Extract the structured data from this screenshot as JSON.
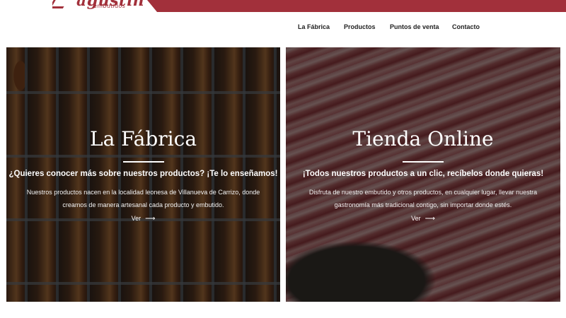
{
  "header": {
    "logo_name": "agustín",
    "logo_sub": "embutidos",
    "nav": [
      {
        "label": "La Fábrica"
      },
      {
        "label": "Productos"
      },
      {
        "label": "Puntos de venta"
      },
      {
        "label": "Contacto"
      }
    ]
  },
  "cards": [
    {
      "title": "La Fábrica",
      "heading": "¿Quieres conocer más sobre nuestros productos? ¡Te lo enseñamos!",
      "text": "Nuestros productos nacen en la localidad leonesa de Villanueva de Carrizo, donde creamos de manera artesanal cada producto y embutido.",
      "link_label": "Ver",
      "link_icon": "arrow-right-icon"
    },
    {
      "title": "Tienda Online",
      "heading": "¡Todos nuestros productos a un clic, recíbelos donde quieras!",
      "text": "Disfruta de nuestro embutido y otros productos, en cualquier lugar, llevar nuestra gastronomía más tradicional contigo, sin importar donde estés.",
      "link_label": "Ver",
      "link_icon": "arrow-right-icon"
    }
  ],
  "colors": {
    "brand": "#a2303b",
    "card_text": "#ffffff"
  }
}
